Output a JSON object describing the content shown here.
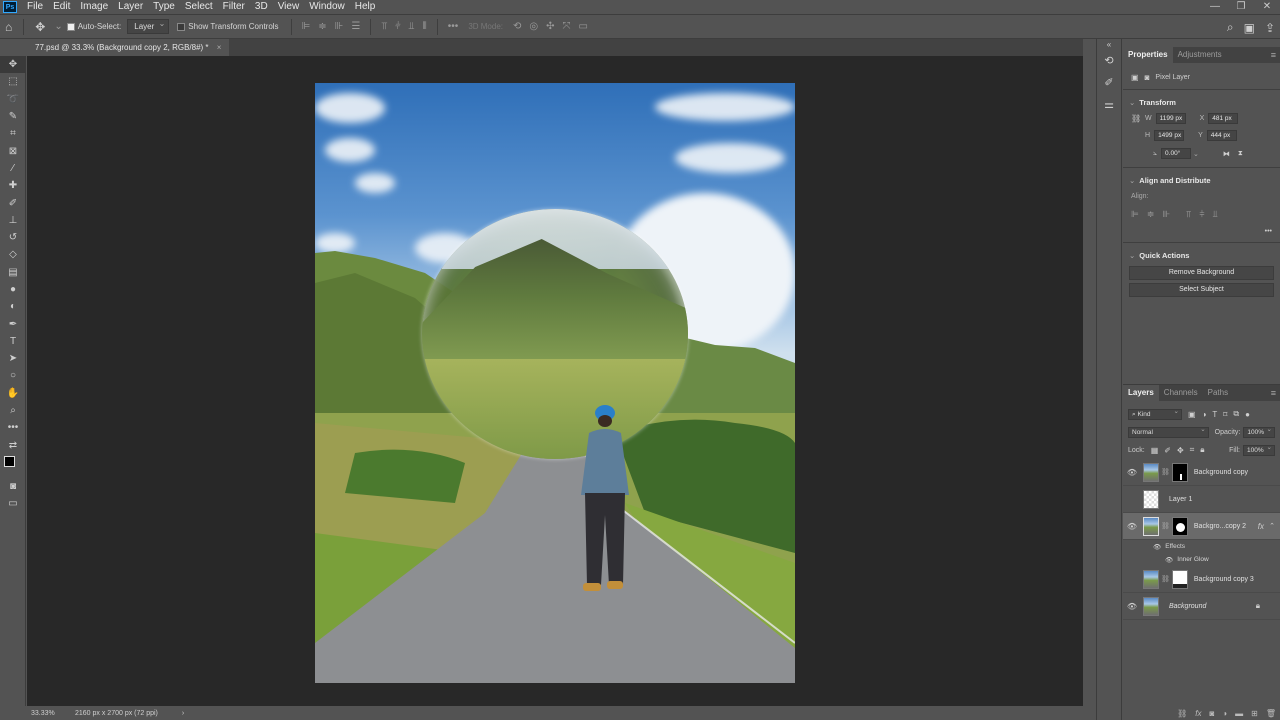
{
  "app": {
    "logo": "Ps"
  },
  "menu": [
    "File",
    "Edit",
    "Image",
    "Layer",
    "Type",
    "Select",
    "Filter",
    "3D",
    "View",
    "Window",
    "Help"
  ],
  "window_controls": [
    "—",
    "❐",
    "✕"
  ],
  "options_bar": {
    "auto_select_label": "Auto-Select:",
    "auto_select_target": "Layer",
    "show_transform_label": "Show Transform Controls",
    "mode_3d_label": "3D Mode:",
    "more_glyph": "•••"
  },
  "document": {
    "tab_title": "77.psd @ 33.3% (Background copy 2, RGB/8#) *",
    "close_glyph": "×"
  },
  "status": {
    "zoom": "33.33%",
    "doc_info": "2160 px x 2700 px (72 ppi)",
    "arrow": "›"
  },
  "properties": {
    "tabs": [
      "Properties",
      "Adjustments"
    ],
    "layer_type": "Pixel Layer",
    "transform_heading": "Transform",
    "w_label": "W",
    "w_value": "1199 px",
    "h_label": "H",
    "h_value": "1499 px",
    "x_label": "X",
    "x_value": "481 px",
    "y_label": "Y",
    "y_value": "444 px",
    "angle_value": "0.00°",
    "align_heading": "Align and Distribute",
    "align_label": "Align:",
    "quick_actions_heading": "Quick Actions",
    "remove_bg_label": "Remove Background",
    "select_subject_label": "Select Subject"
  },
  "layers_panel": {
    "tabs": [
      "Layers",
      "Channels",
      "Paths"
    ],
    "filter_kind": "Kind",
    "blend_mode": "Normal",
    "opacity_label": "Opacity:",
    "opacity_value": "100%",
    "lock_label": "Lock:",
    "fill_label": "Fill:",
    "fill_value": "100%",
    "layers": [
      {
        "name": "Background copy",
        "visible": true
      },
      {
        "name": "Layer 1",
        "visible": false
      },
      {
        "name": "Backgro...copy 2",
        "visible": true,
        "selected": true,
        "fx": "fx"
      },
      {
        "name": "Background copy 3",
        "visible": false
      },
      {
        "name": "Background",
        "visible": true
      }
    ],
    "effects_label": "Effects",
    "inner_glow_label": "Inner Glow"
  },
  "colors": {
    "ui_bg": "#535353",
    "canvas_bg": "#282828",
    "selected_layer": "#6a6a6a",
    "accent": "#31a8ff"
  }
}
